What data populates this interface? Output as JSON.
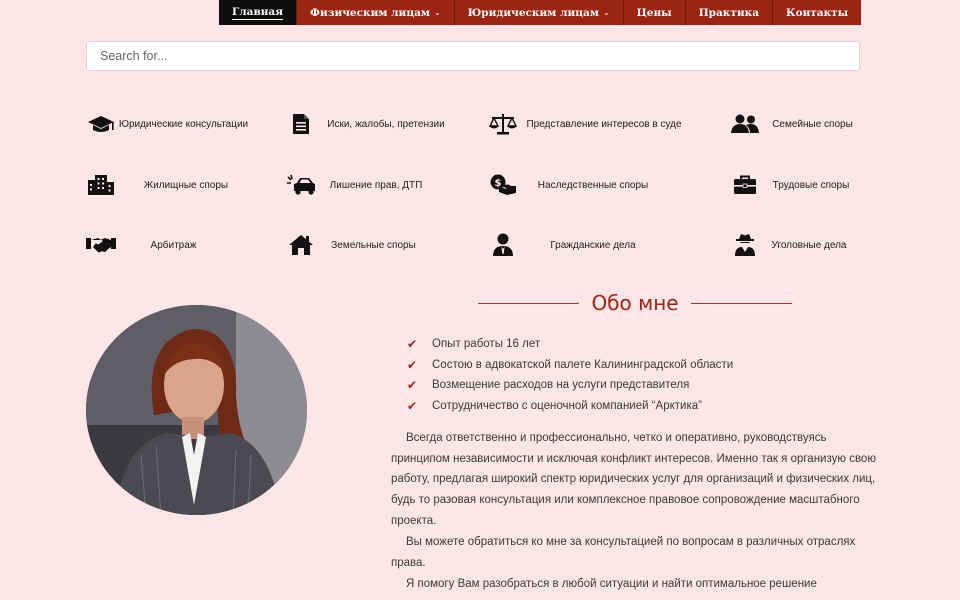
{
  "nav": {
    "items": [
      {
        "label": "Главная",
        "active": true,
        "dropdown": false
      },
      {
        "label": "Физическим лицам",
        "active": false,
        "dropdown": true
      },
      {
        "label": "Юридическим лицам",
        "active": false,
        "dropdown": true
      },
      {
        "label": "Цены",
        "active": false,
        "dropdown": false
      },
      {
        "label": "Практика",
        "active": false,
        "dropdown": false
      },
      {
        "label": "Контакты",
        "active": false,
        "dropdown": false
      }
    ],
    "caret": "⌄"
  },
  "search": {
    "placeholder": "Search for...",
    "value": ""
  },
  "services": [
    {
      "label": "Юридические консультации",
      "icon": "graduation-cap-icon"
    },
    {
      "label": "Иски, жалобы, претензии",
      "icon": "document-icon"
    },
    {
      "label": "Представление интересов в суде",
      "icon": "balance-scale-icon"
    },
    {
      "label": "Семейные споры",
      "icon": "users-icon"
    },
    {
      "label": "Жилищные споры",
      "icon": "building-icon"
    },
    {
      "label": "Лишение прав, ДТП",
      "icon": "car-crash-icon"
    },
    {
      "label": "Наследственные споры",
      "icon": "money-hands-icon"
    },
    {
      "label": "Трудовые споры",
      "icon": "briefcase-icon"
    },
    {
      "label": "Арбитраж",
      "icon": "handshake-icon"
    },
    {
      "label": "Земельные споры",
      "icon": "home-icon"
    },
    {
      "label": "Гражданские дела",
      "icon": "user-tie-icon"
    },
    {
      "label": "Уголовные дела",
      "icon": "user-secret-icon"
    }
  ],
  "about": {
    "title": "Обо мне",
    "check_icon": "✔",
    "checks": [
      "Опыт работы 16 лет",
      "Состою в адвокатской палете Калининградской области",
      "Возмещение расходов на услуги представителя",
      "Сотрудничество с оценочной компанией “Арктика”"
    ],
    "paragraphs": [
      "Всегда ответственно и профессионально, четко и оперативно, руководствуясь принципом независимости и исключая конфликт интересов. Именно так я организую свою работу, предлагая широкий спектр юридических услуг для организаций и физических лиц, будь то разовая консультация или комплексное правовое сопровождение масштабного проекта.",
      "Вы можете обратиться ко мне за консультацией по вопросам в различных отраслях права.",
      "Я помогу Вам разобраться в любой ситуации и найти оптимальное решение"
    ]
  },
  "colors": {
    "brand": "#9b2413",
    "nav_active": "#0e0e0e",
    "background": "#fde6e7"
  }
}
